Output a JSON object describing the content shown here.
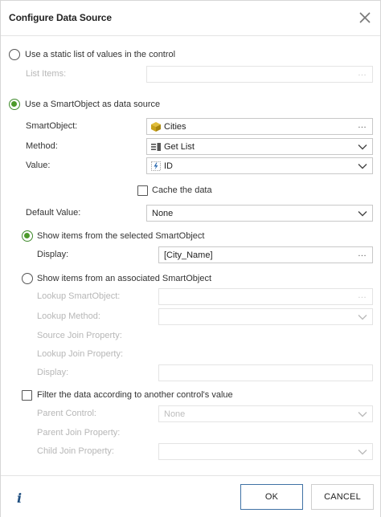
{
  "dialog": {
    "title": "Configure Data Source"
  },
  "static_list": {
    "radio_label": "Use a static list of values in the control",
    "list_items_label": "List Items:",
    "list_items_value": ""
  },
  "smartobject_source": {
    "radio_label": "Use a SmartObject as data source",
    "smartobject_label": "SmartObject:",
    "smartobject_value": "Cities",
    "method_label": "Method:",
    "method_value": "Get List",
    "value_label": "Value:",
    "value_value": "ID",
    "cache_label": "Cache the data",
    "default_value_label": "Default Value:",
    "default_value_value": "None"
  },
  "selected_smartobject": {
    "radio_label": "Show items from the selected SmartObject",
    "display_label": "Display:",
    "display_value": "[City_Name]"
  },
  "associated_smartobject": {
    "radio_label": "Show items from an associated SmartObject",
    "lookup_smartobject_label": "Lookup SmartObject:",
    "lookup_method_label": "Lookup Method:",
    "source_join_label": "Source Join Property:",
    "lookup_join_label": "Lookup Join Property:",
    "display_label": "Display:"
  },
  "filter": {
    "check_label": "Filter the data according to another control's value",
    "parent_control_label": "Parent Control:",
    "parent_control_value": "None",
    "parent_join_label": "Parent Join Property:",
    "child_join_label": "Child Join Property:"
  },
  "ellipsis": "...",
  "footer": {
    "info_glyph": "i",
    "ok_label": "OK",
    "cancel_label": "CANCEL"
  },
  "colors": {
    "radio_selected": "#4c9a2a",
    "ok_border": "#3f72a5",
    "info_icon": "#1f4f80",
    "smartobject_icon": "#c9a21a"
  }
}
